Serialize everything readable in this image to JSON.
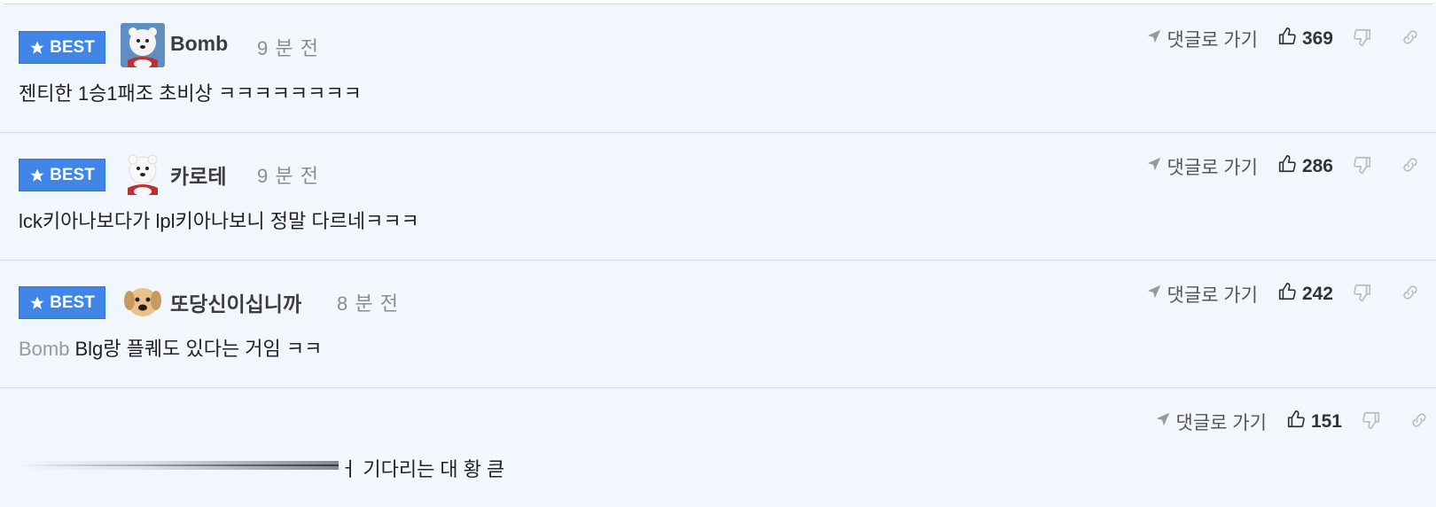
{
  "actions": {
    "goto_label": "댓글로 가기"
  },
  "comments": [
    {
      "best_label": "BEST",
      "username": "Bomb",
      "time": "9 분 전",
      "mention": "",
      "text": "젠티한 1승1패조 초비상 ㅋㅋㅋㅋㅋㅋㅋㅋ",
      "likes": "369",
      "avatar": "polar-bear-avatar"
    },
    {
      "best_label": "BEST",
      "username": "카로테",
      "time": "9 분 전",
      "mention": "",
      "text": "lck키아나보다가 lpl키아나보니 정말 다르네ㅋㅋㅋ",
      "likes": "286",
      "avatar": "polar-bear-avatar"
    },
    {
      "best_label": "BEST",
      "username": "또당신이십니까",
      "time": "8 분 전",
      "mention": "Bomb",
      "text": "Blg랑 플퀘도 있다는 거임 ㅋㅋ",
      "likes": "242",
      "avatar": "puppy-avatar"
    },
    {
      "text_partial": "ㅓ 기다리는 대 황 큳",
      "likes": "151"
    }
  ],
  "colors": {
    "best_badge": "#3f86e8",
    "background": "#f2f6fd",
    "divider": "#d7dade"
  }
}
